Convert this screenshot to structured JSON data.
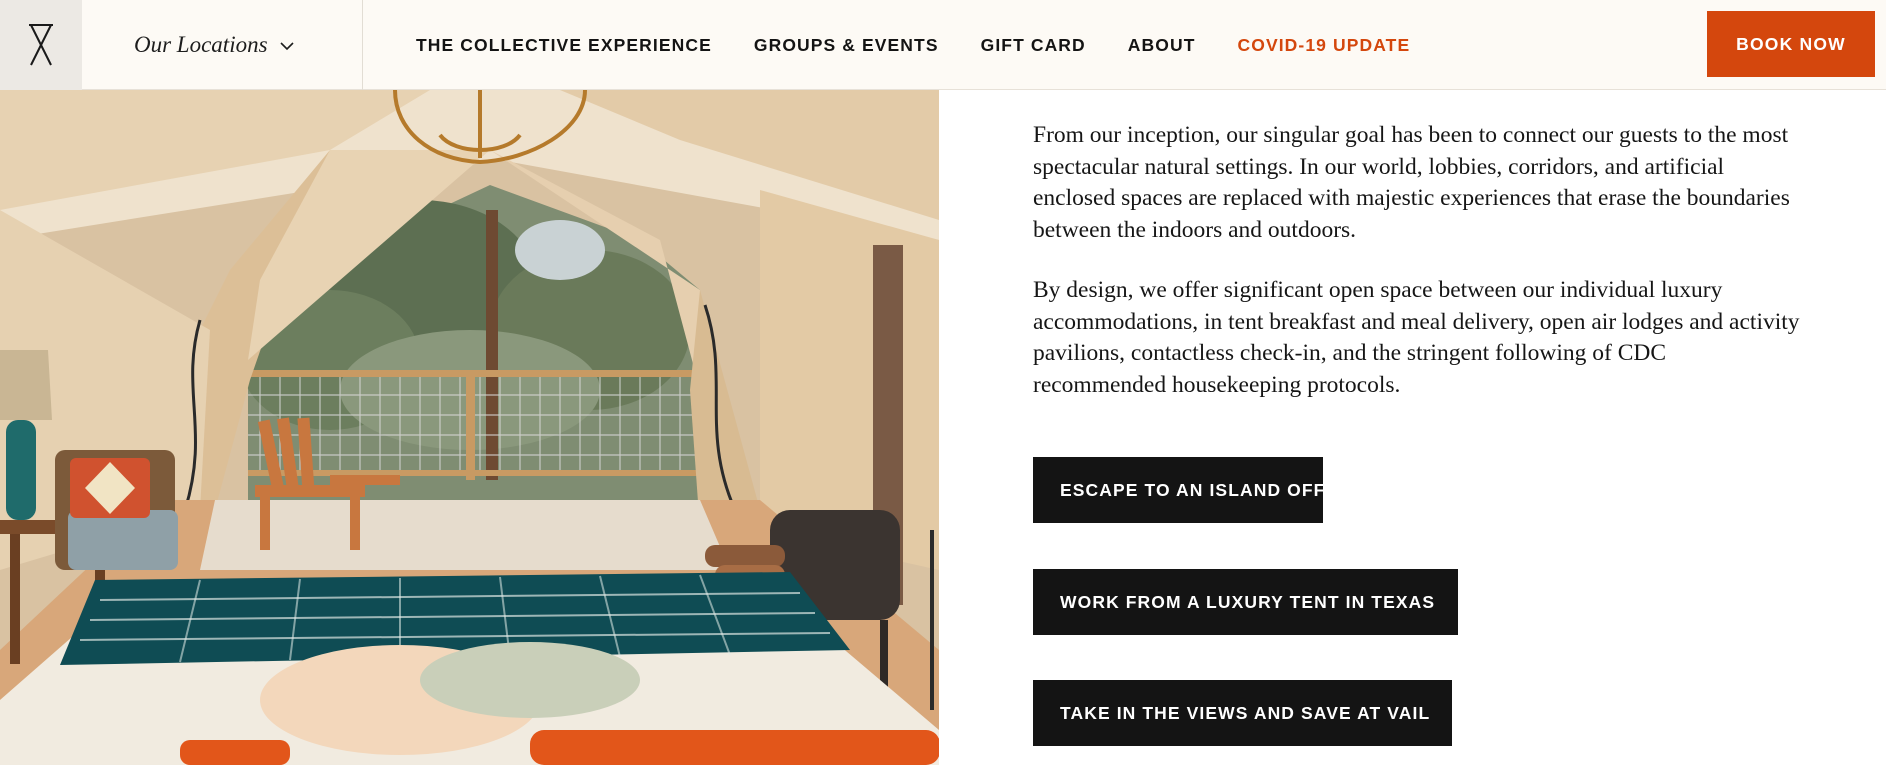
{
  "header": {
    "logo_icon": "collective-x-logo-icon",
    "locations_label": "Our Locations",
    "locations_icon": "chevron-down-icon",
    "nav": [
      {
        "label": "THE COLLECTIVE EXPERIENCE"
      },
      {
        "label": "GROUPS & EVENTS"
      },
      {
        "label": "GIFT CARD"
      },
      {
        "label": "ABOUT"
      },
      {
        "label": "COVID-19 UPDATE"
      }
    ],
    "book_label": "BOOK NOW"
  },
  "main": {
    "paragraphs": [
      "From our inception, our singular goal has been to connect our guests to the most spectacular natural settings. In our world, lobbies, corridors, and artificial enclosed spaces are replaced with majestic experiences that erase the boundaries between the indoors and outdoors.",
      "By design, we offer significant open space between our individual luxury accommodations, in tent breakfast and meal delivery, open air lodges and activity pavilions, contactless check-in, and the stringent following of CDC recommended housekeeping protocols."
    ],
    "ctas": [
      {
        "label": "ESCAPE TO AN ISLAND OFF OF NYC"
      },
      {
        "label": "WORK FROM A LUXURY TENT IN TEXAS"
      },
      {
        "label": "TAKE IN THE VIEWS AND SAVE AT VAIL"
      }
    ]
  },
  "colors": {
    "accent": "#d4470d",
    "header_bg": "#fdfaf5",
    "button_dark": "#141414"
  }
}
